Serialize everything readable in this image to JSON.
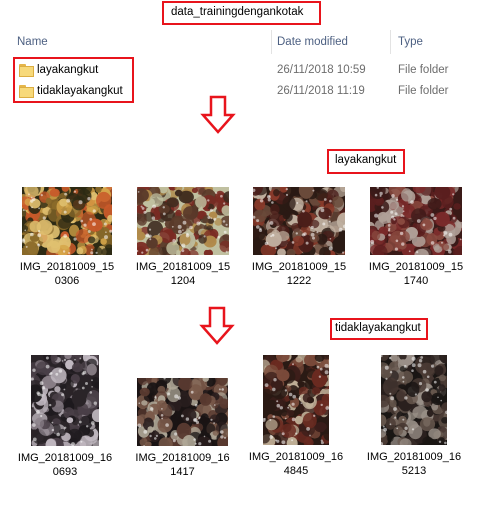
{
  "title": "data_trainingdengankotak",
  "columns": {
    "name": "Name",
    "date_modified": "Date modified",
    "type": "Type"
  },
  "folders": [
    {
      "name": "layakangkut",
      "date": "26/11/2018 10:59",
      "type": "File folder"
    },
    {
      "name": "tidaklayakangkut",
      "date": "26/11/2018 11:19",
      "type": "File folder"
    }
  ],
  "sections": {
    "layak": {
      "label": "layakangkut",
      "images": [
        {
          "line1": "IMG_20181009_15",
          "line2": "0306"
        },
        {
          "line1": "IMG_20181009_15",
          "line2": "1204"
        },
        {
          "line1": "IMG_20181009_15",
          "line2": "1222"
        },
        {
          "line1": "IMG_20181009_15",
          "line2": "1740"
        }
      ]
    },
    "tidak": {
      "label": "tidaklayakangkut",
      "images": [
        {
          "line1": "IMG_20181009_16",
          "line2": "0693"
        },
        {
          "line1": "IMG_20181009_16",
          "line2": "1417"
        },
        {
          "line1": "IMG_20181009_16",
          "line2": "4845"
        },
        {
          "line1": "IMG_20181009_16",
          "line2": "5213"
        }
      ]
    }
  },
  "icons": {
    "folder": "folder-icon",
    "arrow": "down-arrow-icon"
  },
  "colors": {
    "highlight_border": "#e8141c",
    "header_text": "#4d6082",
    "folder_fill": "#f7d97a"
  }
}
